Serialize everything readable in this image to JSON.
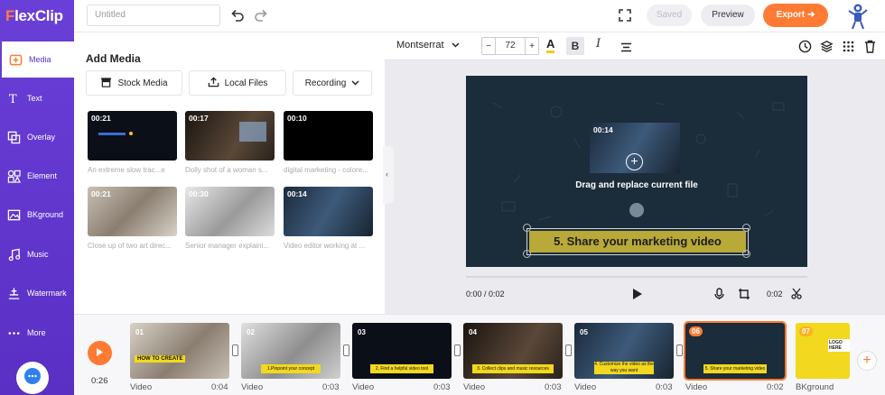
{
  "app": {
    "brand": "FlexClip",
    "title_placeholder": "Untitled"
  },
  "sidebar": {
    "items": [
      {
        "label": "Media",
        "icon": "media-icon",
        "active": true
      },
      {
        "label": "Text",
        "icon": "text-icon"
      },
      {
        "label": "Overlay",
        "icon": "overlay-icon"
      },
      {
        "label": "Element",
        "icon": "element-icon"
      },
      {
        "label": "BKground",
        "icon": "background-icon"
      },
      {
        "label": "Music",
        "icon": "music-icon"
      },
      {
        "label": "Watermark",
        "icon": "watermark-icon"
      },
      {
        "label": "More",
        "icon": "more-icon"
      }
    ]
  },
  "topbar": {
    "saved": "Saved",
    "preview": "Preview",
    "export": "Export"
  },
  "panel": {
    "title": "Add Media",
    "sources": [
      "Stock Media",
      "Local Files",
      "Recording"
    ],
    "thumbs": [
      {
        "dur": "00:21",
        "cap": "An extreme slow trac...e"
      },
      {
        "dur": "00:17",
        "cap": "Dolly shot of a woman s..."
      },
      {
        "dur": "00:10",
        "cap": "digital marketing - colore..."
      },
      {
        "dur": "00:21",
        "cap": "Close up of two art direc..."
      },
      {
        "dur": "00:30",
        "cap": "Senior manager explaini..."
      },
      {
        "dur": "00:14",
        "cap": "Video editor working at ..."
      }
    ]
  },
  "format": {
    "font": "Montserrat",
    "size": "72"
  },
  "canvas": {
    "inner_dur": "00:14",
    "replace_text": "Drag and replace current file",
    "headline": "5. Share your marketing video"
  },
  "player": {
    "time": "0:00 / 0:02",
    "clip_dur": "0:02"
  },
  "timeline": {
    "total": "0:26",
    "clips": [
      {
        "num": "01",
        "type": "Video",
        "dur": "0:04",
        "strip": "HOW TO CREATE"
      },
      {
        "num": "02",
        "type": "Video",
        "dur": "0:03",
        "strip": "1.Pinpoint your concept"
      },
      {
        "num": "03",
        "type": "Video",
        "dur": "0:03",
        "strip": "2. Find a helpful video tool"
      },
      {
        "num": "04",
        "type": "Video",
        "dur": "0:03",
        "strip": "3. Collect clips and music resources"
      },
      {
        "num": "05",
        "type": "Video",
        "dur": "0:03",
        "strip": "4. Customize the video as the way you want"
      },
      {
        "num": "06",
        "type": "Video",
        "dur": "0:02",
        "strip": "5. Share your marketing video"
      },
      {
        "num": "07",
        "type": "BKground",
        "dur": "",
        "strip": "LOGO HERE"
      }
    ]
  },
  "colors": {
    "accent": "#ff7a33",
    "sidebar": "#5a2fc4",
    "headline_bg": "#b8a938"
  }
}
